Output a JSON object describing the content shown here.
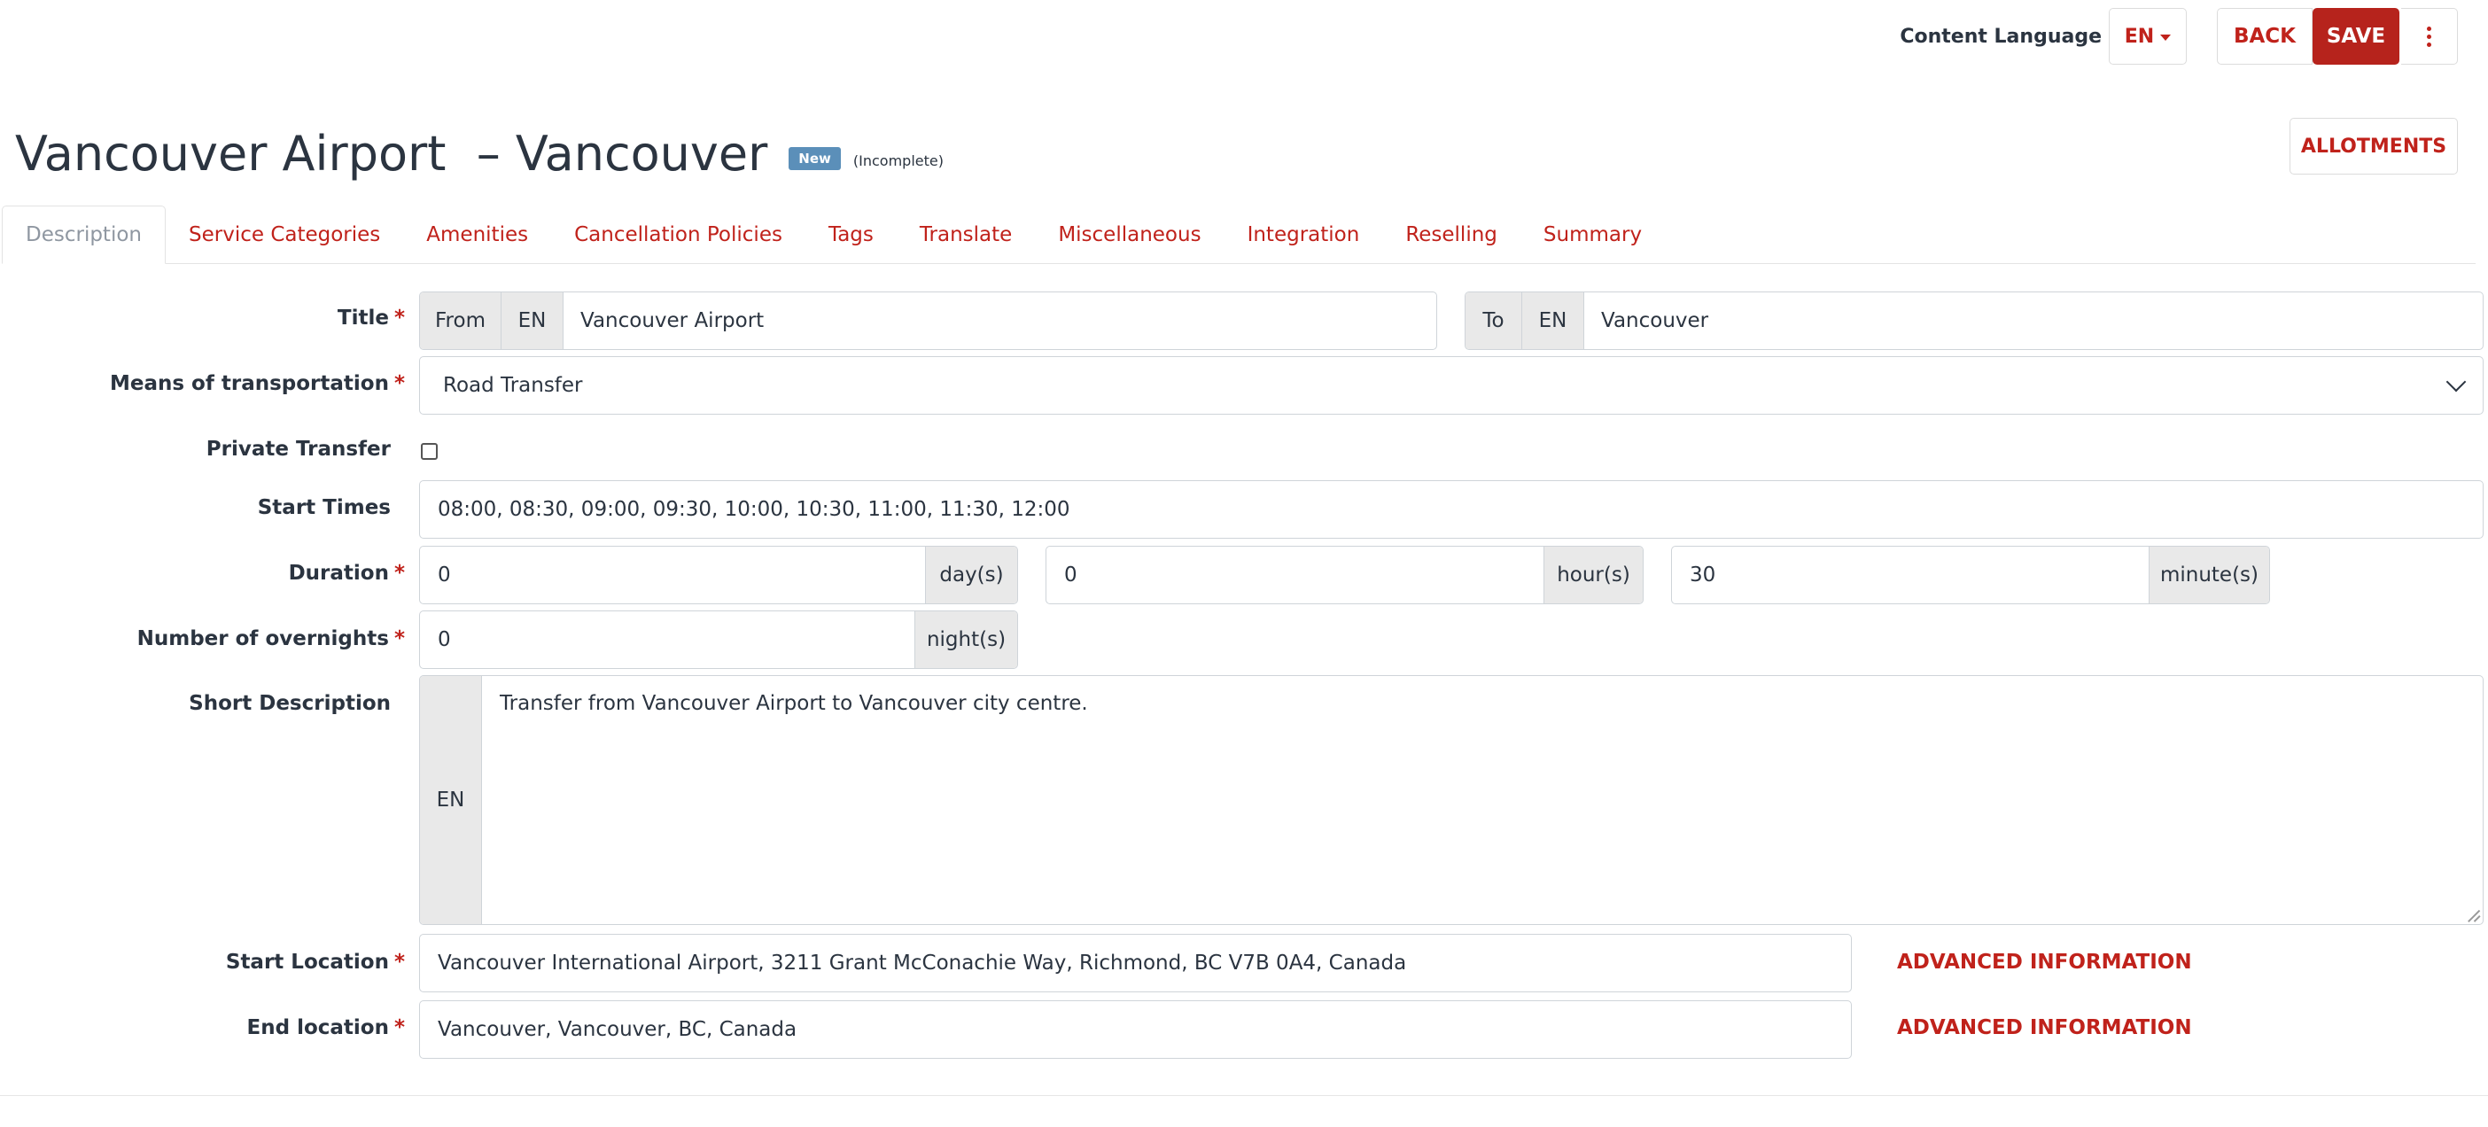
{
  "toolbar": {
    "content_language_label": "Content Language",
    "language_value": "EN",
    "back_label": "BACK",
    "save_label": "SAVE",
    "allotments_label": "ALLOTMENTS"
  },
  "header": {
    "title": "Vancouver Airport  – Vancouver",
    "badge": "New",
    "status": "(Incomplete)"
  },
  "tabs": [
    {
      "label": "Description",
      "active": true
    },
    {
      "label": "Service Categories"
    },
    {
      "label": "Amenities"
    },
    {
      "label": "Cancellation Policies"
    },
    {
      "label": "Tags"
    },
    {
      "label": "Translate"
    },
    {
      "label": "Miscellaneous"
    },
    {
      "label": "Integration"
    },
    {
      "label": "Reselling"
    },
    {
      "label": "Summary"
    }
  ],
  "form": {
    "title": {
      "label": "Title",
      "from_addon": "From",
      "from_lang": "EN",
      "from_value": "Vancouver Airport",
      "to_addon": "To",
      "to_lang": "EN",
      "to_value": "Vancouver"
    },
    "means": {
      "label": "Means of transportation",
      "value": "Road Transfer"
    },
    "private_transfer": {
      "label": "Private Transfer",
      "checked": false
    },
    "start_times": {
      "label": "Start Times",
      "value": "08:00, 08:30, 09:00, 09:30, 10:00, 10:30, 11:00, 11:30, 12:00"
    },
    "duration": {
      "label": "Duration",
      "days": "0",
      "days_unit": "day(s)",
      "hours": "0",
      "hours_unit": "hour(s)",
      "minutes": "30",
      "minutes_unit": "minute(s)"
    },
    "overnights": {
      "label": "Number of overnights",
      "value": "0",
      "unit": "night(s)"
    },
    "short_description": {
      "label": "Short Description",
      "lang": "EN",
      "value": "Transfer from Vancouver Airport to Vancouver city centre."
    },
    "start_location": {
      "label": "Start Location",
      "value": "Vancouver International Airport, 3211 Grant McConachie Way, Richmond, BC V7B 0A4, Canada",
      "advanced": "ADVANCED INFORMATION"
    },
    "end_location": {
      "label": "End location",
      "value": "Vancouver, Vancouver, BC, Canada",
      "advanced": "ADVANCED INFORMATION"
    }
  },
  "colors": {
    "accent": "#c0221b",
    "save_bg": "#b6231c",
    "badge_bg": "#5b8fb9",
    "text": "#2b3440"
  }
}
